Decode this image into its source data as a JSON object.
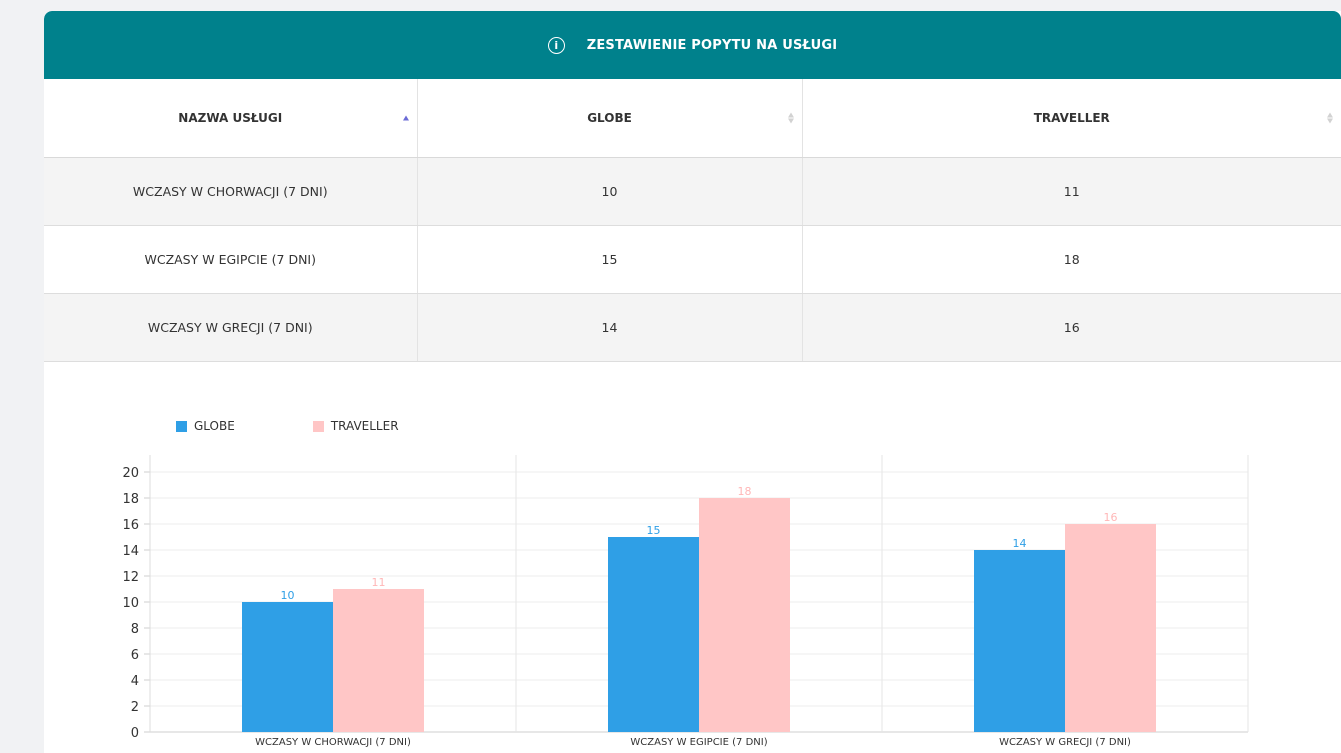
{
  "header": {
    "title": "ZESTAWIENIE POPYTU NA USŁUGI",
    "icon": "info-icon",
    "icon_glyph": "i",
    "color": "#00818c"
  },
  "table": {
    "columns": [
      "NAZWA USŁUGI",
      "GLOBE",
      "TRAVELLER"
    ],
    "rows": [
      [
        "WCZASY W CHORWACJI (7 DNI)",
        "10",
        "11"
      ],
      [
        "WCZASY W EGIPCIE (7 DNI)",
        "15",
        "18"
      ],
      [
        "WCZASY W GRECJI (7 DNI)",
        "14",
        "16"
      ]
    ]
  },
  "chart_data": {
    "type": "bar",
    "categories": [
      "WCZASY W CHORWACJI (7 DNI)",
      "WCZASY W EGIPCIE (7 DNI)",
      "WCZASY W GRECJI (7 DNI)"
    ],
    "series": [
      {
        "name": "GLOBE",
        "values": [
          10,
          15,
          14
        ],
        "color": "#2f9fe6",
        "label_color": "#2f9fe6"
      },
      {
        "name": "TRAVELLER",
        "values": [
          11,
          18,
          16
        ],
        "color": "#ffc6c6",
        "label_color": "#ffb7b7"
      }
    ],
    "ylim": [
      0,
      20
    ],
    "yticks": [
      0,
      2,
      4,
      6,
      8,
      10,
      12,
      14,
      16,
      18,
      20
    ],
    "grid": true,
    "legend": "top-left",
    "title": "",
    "xlabel": "",
    "ylabel": ""
  }
}
